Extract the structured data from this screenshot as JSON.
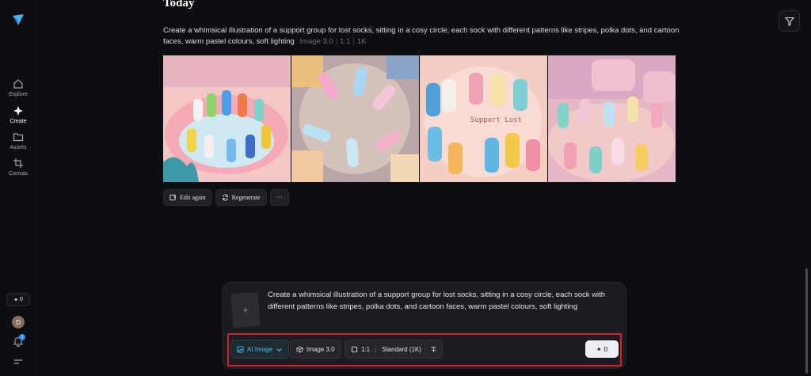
{
  "sidebar": {
    "items": [
      {
        "label": "Explore",
        "icon": "home-icon"
      },
      {
        "label": "Create",
        "icon": "sparkle-icon"
      },
      {
        "label": "Assets",
        "icon": "folder-icon"
      },
      {
        "label": "Canvas",
        "icon": "crop-icon"
      }
    ],
    "credits": "0",
    "avatar_initial": "D",
    "notification_count": "1"
  },
  "main": {
    "heading": "Today",
    "prompt": "Create a whimsical illustration of a support group for lost socks, sitting in a cosy circle, each sock with different patterns like stripes, polka dots, and cartoon faces, warm pastel colours, soft lighting",
    "meta": {
      "model": "Image 3.0",
      "ratio": "1:1",
      "resolution": "1K"
    },
    "image_text": "Support Lost",
    "actions": {
      "edit": "Edit again",
      "regenerate": "Regenerate",
      "more": "···"
    }
  },
  "composer": {
    "text": "Create a whimsical illustration of a support group for lost socks, sitting in a cosy circle, each sock with different patterns like stripes, polka dots, and cartoon faces, warm pastel colours, soft lighting",
    "upload_symbol": "+",
    "toolbar": {
      "mode": "AI Image",
      "model": "Image 3.0",
      "ratio": "1:1",
      "quality": "Standard (1K)",
      "generate_cost": "0"
    }
  },
  "colors": {
    "accent": "#3cc3e8",
    "highlight_frame": "#d5232d",
    "badge": "#2a8cff"
  }
}
